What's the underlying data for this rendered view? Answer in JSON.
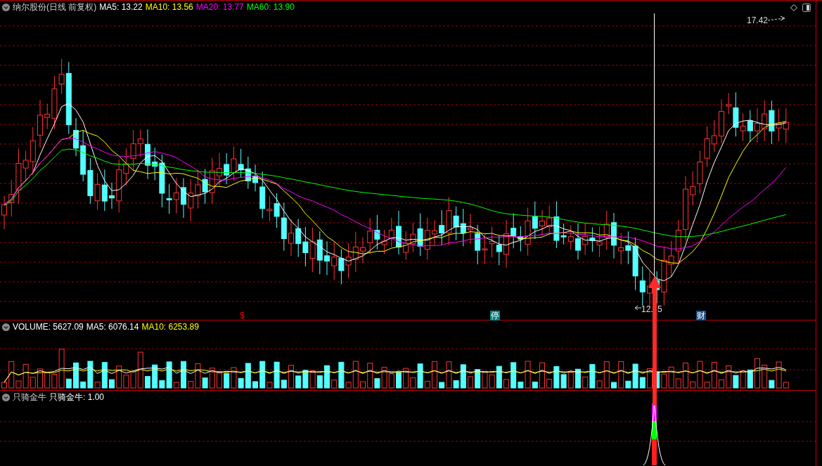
{
  "main_pane": {
    "title": "纳尔股份(日线 前复权)",
    "indicators": [
      {
        "label": "MA5: 13.22",
        "color": "#ffffff"
      },
      {
        "label": "MA10: 13.56",
        "color": "#ffff00"
      },
      {
        "label": "MA20: 13.77",
        "color": "#ff00ff"
      },
      {
        "label": "MA60: 13.90",
        "color": "#00ff00"
      }
    ],
    "high_label": "17.42",
    "low_label_parts": [
      "12.",
      "5"
    ],
    "markers": [
      {
        "text": "$",
        "kind": "plain",
        "color": "#ff0000"
      },
      {
        "text": "停",
        "kind": "boxed",
        "color": "#008080"
      },
      {
        "text": "财",
        "kind": "boxed",
        "color": "#1a4f8a"
      }
    ]
  },
  "volume_pane": {
    "indicators": [
      {
        "label": "VOLUME: 5627.09",
        "color": "#ffffff"
      },
      {
        "label": "MA5: 6076.14",
        "color": "#ffffff"
      },
      {
        "label": "MA10: 6253.89",
        "color": "#ffff00"
      }
    ]
  },
  "signal_pane": {
    "title": "只骑金牛",
    "indicators": [
      {
        "label": "只骑金牛: 1.00",
        "color": "#ffffff"
      }
    ]
  }
}
